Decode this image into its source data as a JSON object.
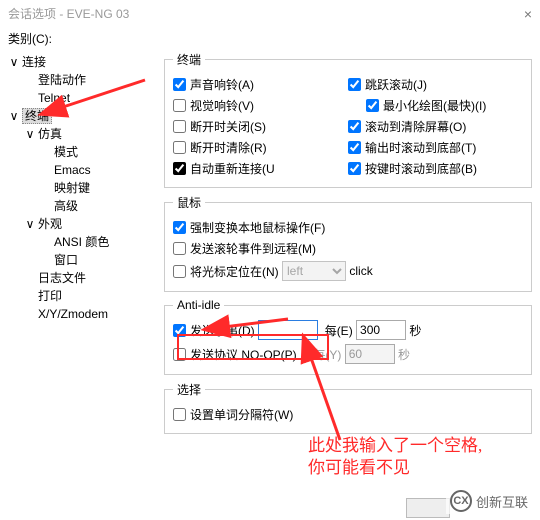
{
  "window": {
    "title": "会话选项 - EVE-NG 03",
    "close_icon": "×"
  },
  "category_label": "类别(C):",
  "tree": {
    "root_conn": "连接",
    "login_action": "登陆动作",
    "telnet": "Telnet",
    "terminal": "终端",
    "emulation": "仿真",
    "mode": "模式",
    "emacs": "Emacs",
    "mapkey": "映射键",
    "advanced": "高级",
    "appearance": "外观",
    "ansi_color": "ANSI 颜色",
    "window": "窗口",
    "logfile": "日志文件",
    "print": "打印",
    "xyzmodem": "X/Y/Zmodem"
  },
  "panel": {
    "group_terminal": "终端",
    "sound_bell": "声音响铃(A)",
    "jump_scroll": "跳跃滚动(J)",
    "visual_bell": "视觉响铃(V)",
    "minimize_draw": "最小化绘图(最快)(I)",
    "close_on_disconnect": "断开时关闭(S)",
    "scroll_to_clear": "滚动到清除屏幕(O)",
    "clear_on_disconnect": "断开时清除(R)",
    "scroll_bottom_output": "输出时滚动到底部(T)",
    "auto_reconnect": "自动重新连接(U",
    "scroll_bottom_key": "按键时滚动到底部(B)",
    "group_mouse": "鼠标",
    "force_local_mouse": "强制变换本地鼠标操作(F)",
    "send_wheel_remote": "发送滚轮事件到远程(M)",
    "locate_cursor": "将光标定位在(N)",
    "cursor_option": "left",
    "cursor_after": "click",
    "group_anti_idle": "Anti-idle",
    "send_string": "发送字串(D)",
    "send_string_value": "",
    "every_e": "每(E)",
    "every_value": "300",
    "seconds": "秒",
    "send_noop": "发送协议 NO-OP(P)",
    "every_y": "每(Y)",
    "noop_value": "60",
    "group_select": "选择",
    "set_word_delim": "设置单词分隔符(W)"
  },
  "annotations": {
    "line1": "此处我输入了一个空格,",
    "line2": "你可能看不见"
  },
  "watermark": {
    "text": "创新互联",
    "logo_letters": "CX"
  }
}
